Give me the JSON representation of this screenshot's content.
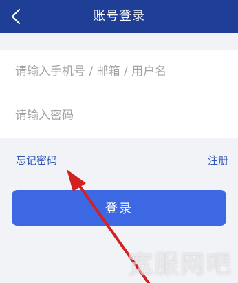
{
  "header": {
    "title": "账号登录",
    "back_icon": "chevron-left-icon"
  },
  "form": {
    "account_placeholder": "请输入手机号 / 邮箱 / 用户名",
    "account_value": "",
    "password_placeholder": "请输入密码",
    "password_value": ""
  },
  "links": {
    "forgot_password": "忘记密码",
    "register": "注册"
  },
  "login_button": {
    "label": "登录"
  },
  "watermark": {
    "text": "宽服网吧"
  },
  "colors": {
    "header_bg": "#1f3f96",
    "page_bg": "#f2f3f7",
    "link": "#2f55b7",
    "primary_button": "#3d68e3",
    "annotation_arrow": "#d42020"
  }
}
